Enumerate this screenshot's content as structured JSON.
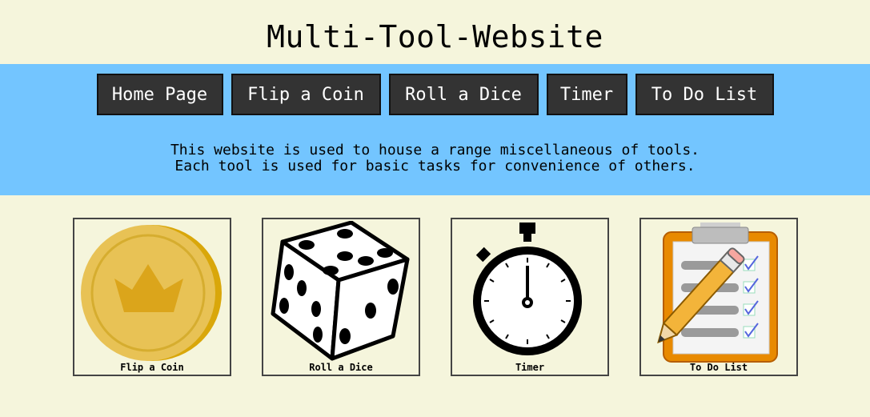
{
  "site": {
    "title": "Multi-Tool-Website"
  },
  "nav": {
    "items": [
      {
        "label": "Home Page",
        "name": "nav-home-page"
      },
      {
        "label": "Flip a Coin",
        "name": "nav-flip-a-coin"
      },
      {
        "label": "Roll a Dice",
        "name": "nav-roll-a-dice"
      },
      {
        "label": "Timer",
        "name": "nav-timer"
      },
      {
        "label": "To Do List",
        "name": "nav-to-do-list"
      }
    ]
  },
  "description": {
    "line1": "This website is used to house a range miscellaneous of tools.",
    "line2": "Each tool is used for basic tasks for convenience of others."
  },
  "tools": [
    {
      "label": "Flip a Coin",
      "icon": "coin-icon"
    },
    {
      "label": "Roll a Dice",
      "icon": "dice-icon"
    },
    {
      "label": "Timer",
      "icon": "stopwatch-icon"
    },
    {
      "label": "To Do List",
      "icon": "clipboard-icon"
    }
  ],
  "colors": {
    "background": "#f5f5dc",
    "band": "#73c5ff",
    "button": "#333333"
  }
}
